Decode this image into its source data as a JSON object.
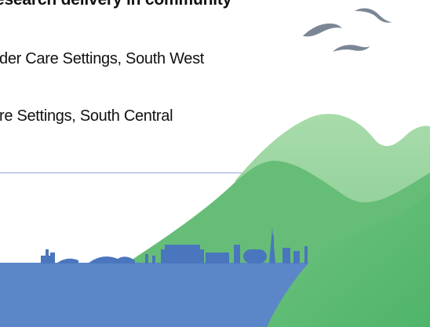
{
  "content": {
    "heading_line": "research delivery in community",
    "item_1": "der Care Settings, South West",
    "item_2": "re Settings, South Central"
  },
  "colors": {
    "text": "#111111",
    "divider": "#93a7d9",
    "hill_back": "#8dcf96",
    "hill_front": "#5dbb73",
    "water": "#5b86c8",
    "skyline": "#4a76bd",
    "bird": "#7a8694"
  },
  "icons": {
    "birds": "bird-icon",
    "skyline": "city-skyline-icon"
  }
}
